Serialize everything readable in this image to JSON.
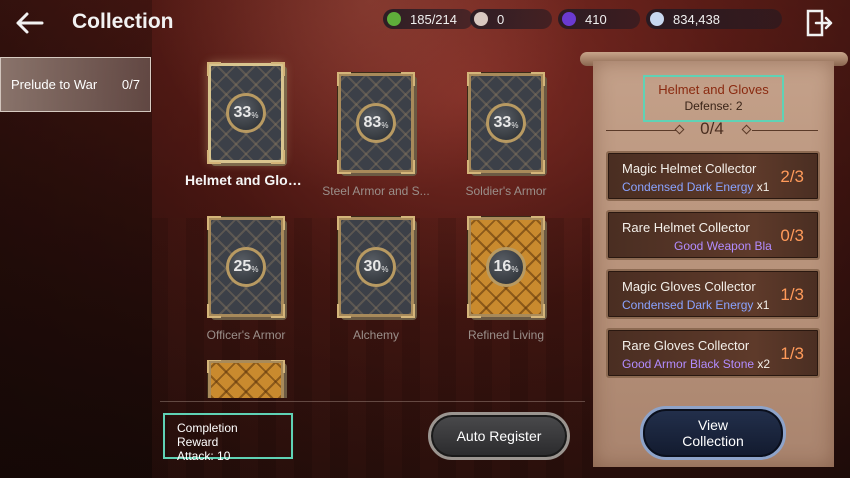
{
  "header": {
    "title": "Collection",
    "resources": [
      {
        "icon": "green-gem-icon",
        "color": "#5fae3a",
        "value": "185/214"
      },
      {
        "icon": "pearl-icon",
        "color": "#d8c8c0",
        "value": "0"
      },
      {
        "icon": "purple-orb-icon",
        "color": "#6a3ad0",
        "value": "410"
      },
      {
        "icon": "silver-coin-icon",
        "color": "#c8d8f0",
        "value": "834,438"
      }
    ]
  },
  "sidebar": {
    "tab": {
      "label": "Prelude to War",
      "count": "0/7"
    }
  },
  "cards": [
    {
      "label": "Helmet and Gloves",
      "percent": "33",
      "style": "dark",
      "selected": true
    },
    {
      "label": "Steel Armor and S...",
      "percent": "83",
      "style": "dark",
      "selected": false
    },
    {
      "label": "Soldier's Armor",
      "percent": "33",
      "style": "dark",
      "selected": false
    },
    {
      "label": "Officer's Armor",
      "percent": "25",
      "style": "dark",
      "selected": false
    },
    {
      "label": "Alchemy",
      "percent": "30",
      "style": "dark",
      "selected": false
    },
    {
      "label": "Refined Living",
      "percent": "16",
      "style": "gold",
      "selected": false
    }
  ],
  "percent_sign": "%",
  "reward": {
    "title": "Completion Reward",
    "stat": "Attack: 10"
  },
  "buttons": {
    "auto_register": "Auto Register",
    "view_line1": "View",
    "view_line2": "Collection"
  },
  "detail": {
    "name": "Helmet and Gloves",
    "stat": "Defense: 2",
    "progress": "0/4",
    "collectors": [
      {
        "name": "Magic Helmet Collector",
        "item": "Condensed Dark Energy",
        "qty": " x1",
        "count": "2/3",
        "rare": false
      },
      {
        "name": "Rare Helmet Collector",
        "item": "Good Weapon Bla",
        "qty": "",
        "count": "0/3",
        "rare": true
      },
      {
        "name": "Magic Gloves Collector",
        "item": "Condensed Dark Energy",
        "qty": " x1",
        "count": "1/3",
        "rare": false
      },
      {
        "name": "Rare Gloves Collector",
        "item": "Good Armor Black Stone",
        "qty": " x2",
        "count": "1/3",
        "rare": true
      }
    ]
  }
}
